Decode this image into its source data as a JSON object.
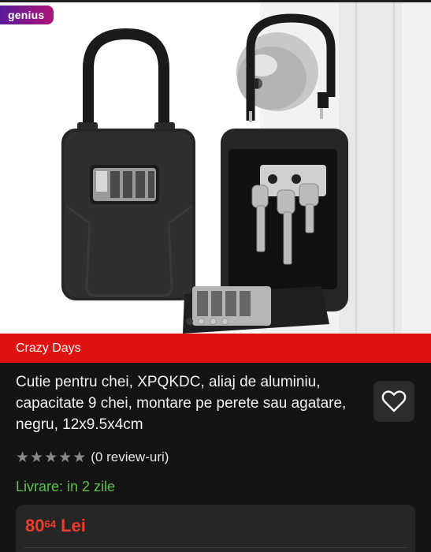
{
  "badge": {
    "label": "genius"
  },
  "gallery": {
    "dot_count": 4,
    "active_index": 0
  },
  "promo": {
    "label": "Crazy Days"
  },
  "product": {
    "title": "Cutie pentru chei, XPQKDC, aliaj de aluminiu, capacitate 9 chei, montare pe perete sau agatare, negru, 12x9.5x4cm",
    "rating": {
      "stars_filled": 0,
      "stars_total": 5,
      "review_label": "(0 review-uri)"
    },
    "delivery": "Livrare: in 2 zile",
    "price": {
      "integer": "80",
      "decimals": "64",
      "currency": "Lei"
    }
  },
  "icons": {
    "favorite": "heart-outline-icon",
    "star": "star-icon"
  },
  "colors": {
    "promo_bg": "#e0120f",
    "price": "#f23a2f",
    "delivery": "#5cc14a",
    "genius_start": "#5a1a9a",
    "genius_end": "#b0147a"
  }
}
